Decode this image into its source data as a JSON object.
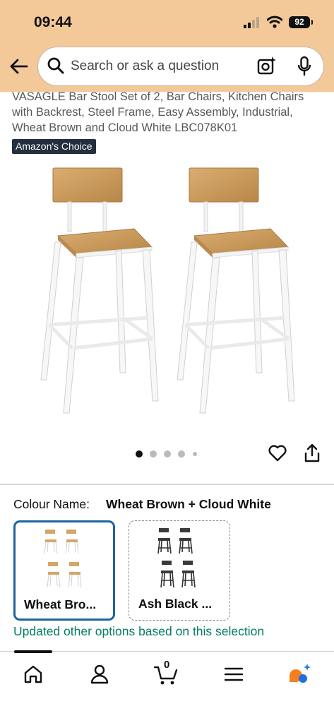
{
  "status_bar": {
    "time": "09:44",
    "battery": "92"
  },
  "header": {
    "search_placeholder": "Search or ask a question"
  },
  "product": {
    "title": "VASAGLE Bar Stool Set of 2, Bar Chairs, Kitchen Chairs with Backrest, Steel Frame, Easy Assembly, Industrial, Wheat Brown and Cloud White LBC078K01",
    "badge": "Amazon's Choice",
    "image_count": 5,
    "image_active_index": 0
  },
  "variation": {
    "label": "Colour Name:",
    "value": "Wheat Brown + Cloud White",
    "options": [
      {
        "label": "Wheat Bro...",
        "selected": true
      },
      {
        "label": "Ash Black ...",
        "selected": false
      }
    ],
    "notice": "Updated other options based on this selection"
  },
  "bottom_nav": {
    "cart_count": "0",
    "items": [
      "home-icon",
      "account-icon",
      "cart-icon",
      "menu-icon",
      "rufus-icon"
    ]
  },
  "colors": {
    "header_bg": "#f3c99a",
    "selected_border": "#2162a1",
    "notice_green": "#067d62",
    "badge_bg": "#232f3e",
    "rufus_orange": "#f57f20",
    "rufus_blue": "#1f6fe0"
  }
}
